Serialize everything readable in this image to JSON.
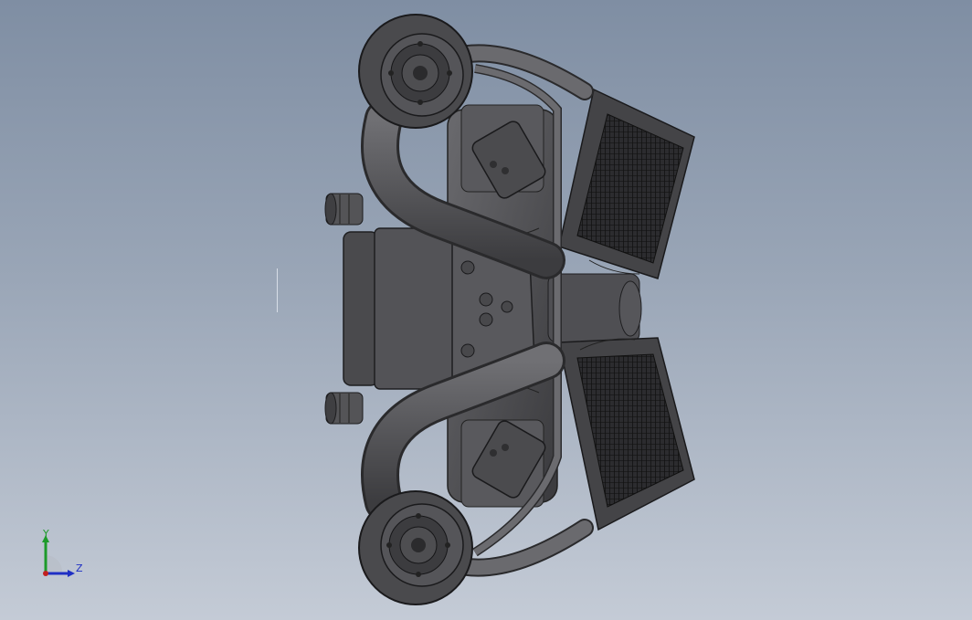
{
  "viewport": {
    "background_top": "#7f8ea3",
    "background_bottom": "#c4cbd6",
    "model_color": "#4d4d50"
  },
  "triad": {
    "y_label": "Y",
    "z_label": "Z",
    "y_color": "#1d9a2a",
    "z_color": "#1f2fc4",
    "x_color": "#c21f1f"
  }
}
